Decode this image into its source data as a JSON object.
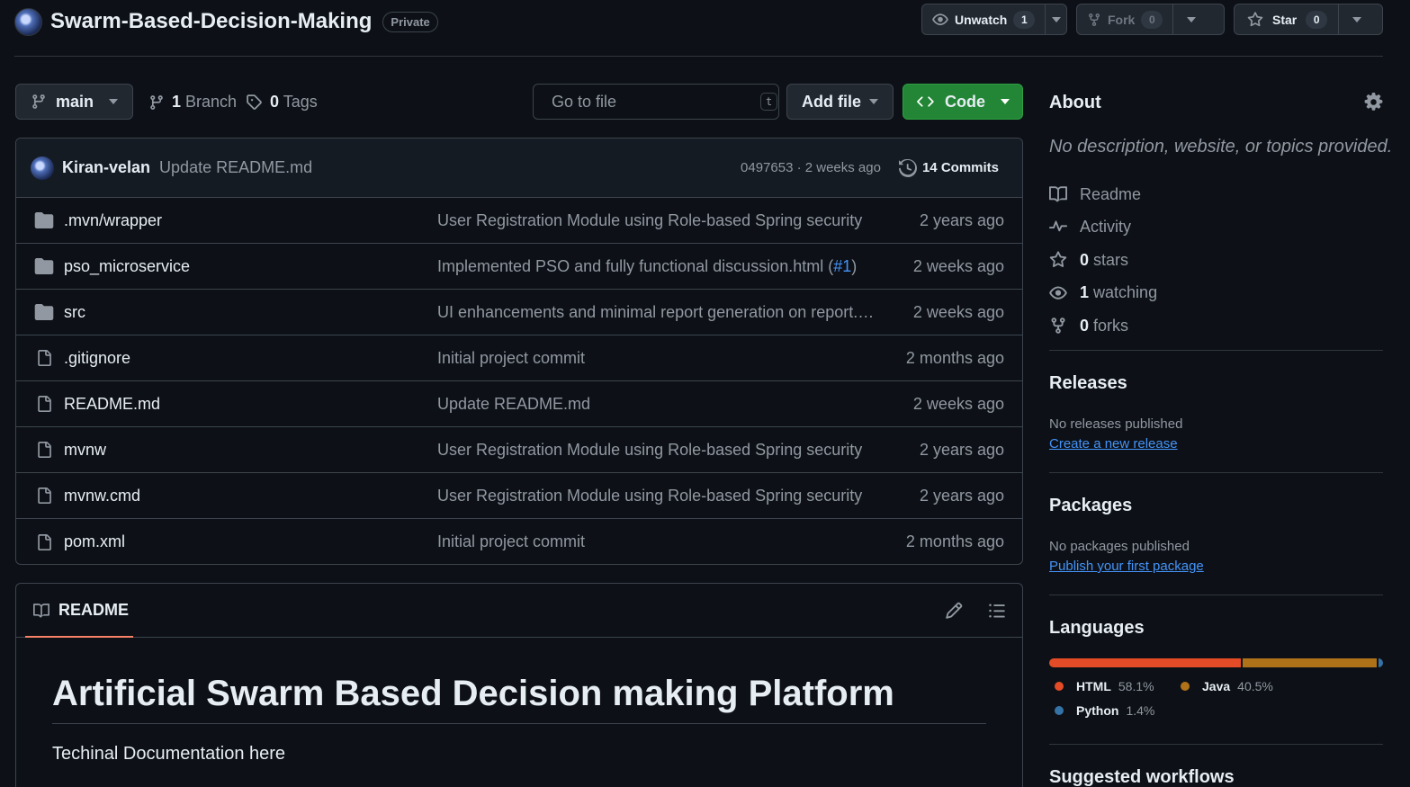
{
  "repo": {
    "name": "Swarm-Based-Decision-Making",
    "visibility": "Private"
  },
  "header_actions": {
    "watch": {
      "label": "Unwatch",
      "count": "1"
    },
    "fork": {
      "label": "Fork",
      "count": "0"
    },
    "star": {
      "label": "Star",
      "count": "0"
    }
  },
  "toolbar": {
    "branch": "main",
    "branches_count": "1",
    "branches_label": "Branch",
    "tags_count": "0",
    "tags_label": "Tags",
    "search_placeholder": "Go to file",
    "search_shortcut": "t",
    "add_file_label": "Add file",
    "code_label": "Code"
  },
  "latest_commit": {
    "author": "Kiran-velan",
    "message": "Update README.md",
    "hash_time": "0497653 · 2 weeks ago",
    "commits_label": "14 Commits"
  },
  "files": [
    {
      "type": "folder",
      "name": ".mvn/wrapper",
      "commit": "User Registration Module using Role-based Spring security",
      "pr": "",
      "pr_suffix": "",
      "date": "2 years ago"
    },
    {
      "type": "folder",
      "name": "pso_microservice",
      "commit": "Implemented PSO and fully functional discussion.html (",
      "pr": "#1",
      "pr_suffix": ")",
      "date": "2 weeks ago"
    },
    {
      "type": "folder",
      "name": "src",
      "commit": "UI enhancements and minimal report generation on report.h...",
      "pr": "",
      "pr_suffix": "",
      "date": "2 weeks ago"
    },
    {
      "type": "file",
      "name": ".gitignore",
      "commit": "Initial project commit",
      "pr": "",
      "pr_suffix": "",
      "date": "2 months ago"
    },
    {
      "type": "file",
      "name": "README.md",
      "commit": "Update README.md",
      "pr": "",
      "pr_suffix": "",
      "date": "2 weeks ago"
    },
    {
      "type": "file",
      "name": "mvnw",
      "commit": "User Registration Module using Role-based Spring security",
      "pr": "",
      "pr_suffix": "",
      "date": "2 years ago"
    },
    {
      "type": "file",
      "name": "mvnw.cmd",
      "commit": "User Registration Module using Role-based Spring security",
      "pr": "",
      "pr_suffix": "",
      "date": "2 years ago"
    },
    {
      "type": "file",
      "name": "pom.xml",
      "commit": "Initial project commit",
      "pr": "",
      "pr_suffix": "",
      "date": "2 months ago"
    }
  ],
  "readme": {
    "tab_label": "README",
    "heading": "Artificial Swarm Based Decision making Platform",
    "paragraph": "Techinal Documentation here"
  },
  "about": {
    "title": "About",
    "description": "No description, website, or topics provided.",
    "items": [
      {
        "icon": "book-icon",
        "value": "",
        "label": "Readme"
      },
      {
        "icon": "pulse-icon",
        "value": "",
        "label": "Activity"
      },
      {
        "icon": "star-icon",
        "value": "0",
        "label": "stars"
      },
      {
        "icon": "eye-icon",
        "value": "1",
        "label": "watching"
      },
      {
        "icon": "fork-icon",
        "value": "0",
        "label": "forks"
      }
    ]
  },
  "releases": {
    "title": "Releases",
    "empty_text": "No releases published",
    "link": "Create a new release"
  },
  "packages": {
    "title": "Packages",
    "empty_text": "No packages published",
    "link": "Publish your first package"
  },
  "languages": {
    "title": "Languages",
    "items": [
      {
        "name": "HTML",
        "percent": "58.1%",
        "value": 58.1,
        "color": "#e34c26"
      },
      {
        "name": "Java",
        "percent": "40.5%",
        "value": 40.5,
        "color": "#b07219"
      },
      {
        "name": "Python",
        "percent": "1.4%",
        "value": 1.4,
        "color": "#3572A5"
      }
    ]
  },
  "suggested": {
    "title": "Suggested workflows"
  },
  "colors": {
    "background": "#0d1117",
    "border": "#3d444d",
    "accent_link": "#4493f8",
    "code_button": "#238636",
    "readme_underline": "#f78166"
  }
}
